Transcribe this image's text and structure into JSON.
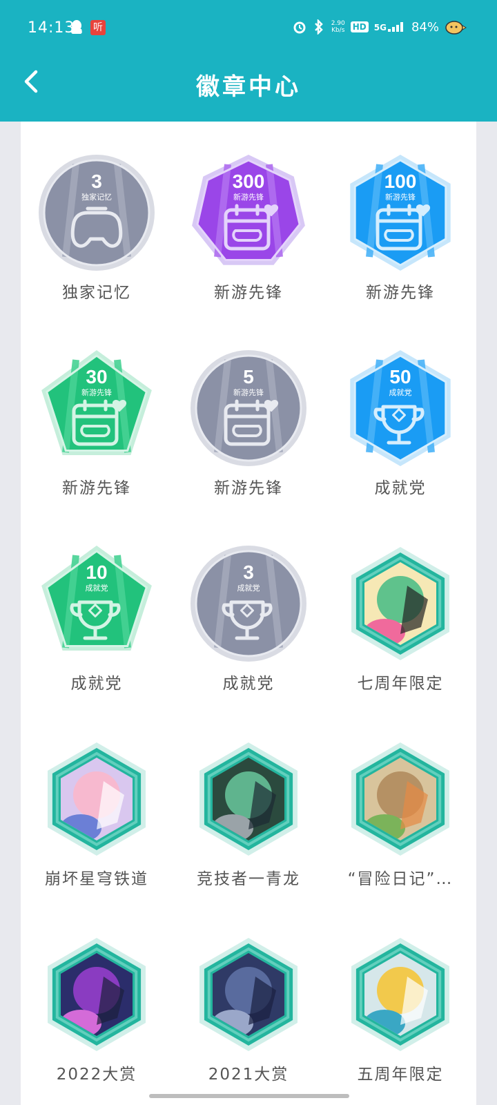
{
  "status_bar": {
    "time": "14:13",
    "net_speed_value": "2.90",
    "net_speed_unit": "Kb/s",
    "hd_label": "HD",
    "network": "5G",
    "battery": "84%",
    "app_badge": "听"
  },
  "header": {
    "title": "徽章中心"
  },
  "colors": {
    "header": "#1ab3c2",
    "gray_badge": "#8b91a6",
    "purple_badge": "#9a46e8",
    "blue_badge": "#1a9cf4",
    "green_badge": "#22c27c",
    "teal_frame": "#23b59e"
  },
  "badges": [
    {
      "label": "独家记忆",
      "count": "3",
      "subtitle": "独家记忆",
      "kind": "tap",
      "color": "gray",
      "shape": "circle"
    },
    {
      "label": "新游先锋",
      "count": "300",
      "subtitle": "新游先锋",
      "kind": "calendar",
      "color": "purple",
      "shape": "heptagon"
    },
    {
      "label": "新游先锋",
      "count": "100",
      "subtitle": "新游先锋",
      "kind": "calendar",
      "color": "blue",
      "shape": "hexagon"
    },
    {
      "label": "新游先锋",
      "count": "30",
      "subtitle": "新游先锋",
      "kind": "calendar",
      "color": "green",
      "shape": "pentagon"
    },
    {
      "label": "新游先锋",
      "count": "5",
      "subtitle": "新游先锋",
      "kind": "calendar",
      "color": "gray",
      "shape": "circle"
    },
    {
      "label": "成就党",
      "count": "50",
      "subtitle": "成就党",
      "kind": "trophy",
      "color": "blue",
      "shape": "hexagon"
    },
    {
      "label": "成就党",
      "count": "10",
      "subtitle": "成就党",
      "kind": "trophy",
      "color": "green",
      "shape": "pentagon"
    },
    {
      "label": "成就党",
      "count": "3",
      "subtitle": "成就党",
      "kind": "trophy",
      "color": "gray",
      "shape": "circle"
    },
    {
      "label": "七周年限定",
      "kind": "art",
      "art": "seventh-anniversary-art",
      "color": "teal",
      "shape": "hexframe"
    },
    {
      "label": "崩坏星穹铁道",
      "kind": "art",
      "art": "pink-hair-character-art",
      "color": "teal",
      "shape": "hexframe"
    },
    {
      "label": "竞技者一青龙",
      "kind": "art",
      "art": "armored-hero-art",
      "color": "teal",
      "shape": "hexframe"
    },
    {
      "label": "“冒险日记”…",
      "kind": "art",
      "art": "adventure-diary-art",
      "color": "teal",
      "shape": "hexframe"
    },
    {
      "label": "2022大赏",
      "kind": "art",
      "art": "purple-mech-art",
      "color": "teal",
      "shape": "hexframe"
    },
    {
      "label": "2021大赏",
      "kind": "art",
      "art": "dark-mech-art",
      "color": "teal",
      "shape": "hexframe"
    },
    {
      "label": "五周年限定",
      "kind": "art",
      "art": "fifth-anniversary-art",
      "color": "teal",
      "shape": "hexframe"
    }
  ]
}
